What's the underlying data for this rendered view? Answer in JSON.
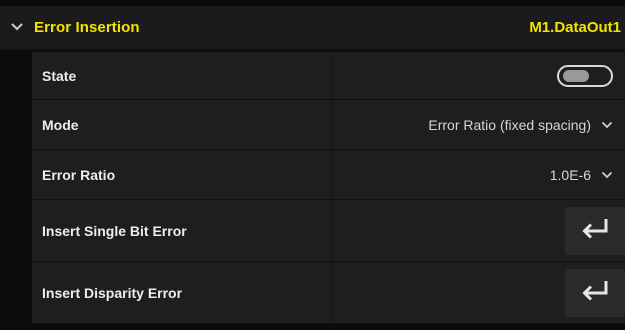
{
  "colors": {
    "accent": "#f2e400",
    "text": "#ededed",
    "value_text": "#d6d6d6",
    "row_bg": "#1e1e20",
    "button_bg": "#2a2a2d"
  },
  "section": {
    "title": "Error Insertion",
    "target": "M1.DataOut1",
    "expanded_icon": "chevron-down-icon"
  },
  "rows": {
    "state": {
      "label": "State",
      "toggle_on": false
    },
    "mode": {
      "label": "Mode",
      "value": "Error Ratio (fixed spacing)",
      "icon": "chevron-down-icon"
    },
    "error_ratio": {
      "label": "Error Ratio",
      "value": "1.0E-6",
      "icon": "chevron-down-icon"
    },
    "insert_single": {
      "label": "Insert Single Bit Error",
      "icon": "enter-return-icon"
    },
    "insert_disparity": {
      "label": "Insert Disparity Error",
      "icon": "enter-return-icon"
    }
  }
}
